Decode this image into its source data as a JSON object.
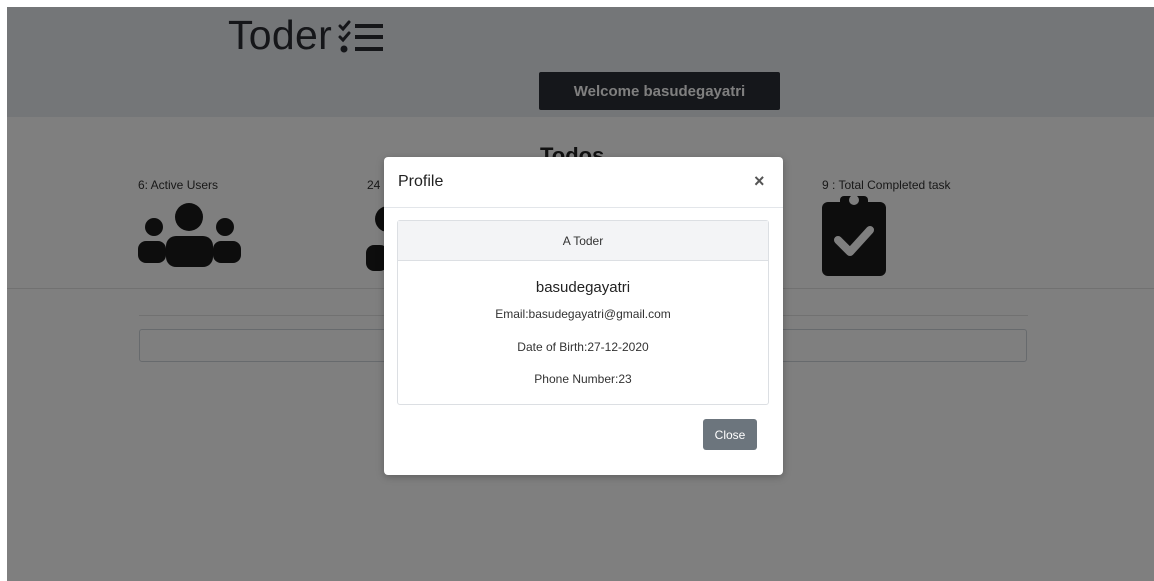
{
  "app": {
    "title": "Toder",
    "welcome": "Welcome basudegayatri"
  },
  "main": {
    "title": "Todos",
    "stats": {
      "active_users": "6: Active Users",
      "second_partial": "24",
      "completed": "9 : Total Completed task"
    },
    "icons": [
      "users-icon",
      "user-icon",
      "clipboard-check-icon",
      "checklist-icon"
    ]
  },
  "modal": {
    "title": "Profile",
    "close_symbol": "×",
    "card_header": "A Toder",
    "name": "basudegayatri",
    "email": "Email:basudegayatri@gmail.com",
    "dob": "Date of Birth:27-12-2020",
    "phone": "Phone Number:23",
    "close_label": "Close"
  },
  "colors": {
    "header_bg": "#e9ecf1",
    "welcome_bg": "#2b2e36",
    "icon_dark": "#1b1b1b",
    "close_btn": "#6c757d"
  }
}
